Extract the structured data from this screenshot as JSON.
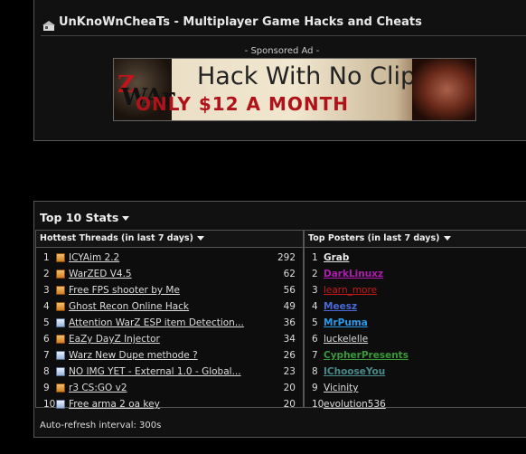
{
  "header": {
    "site_title": "UnKnoWnCheaTs - Multiplayer Game Hacks and Cheats",
    "sponsored_label": "- Sponsored Ad -"
  },
  "banner": {
    "logo_text_a": "WAr",
    "logo_text_b": "Z",
    "line1": "Hack With No Clip",
    "line2": "ONLY $12 A MONTH"
  },
  "stats": {
    "title": "Top 10 Stats",
    "threads_header": "Hottest Threads (in last 7 days)",
    "posters_header": "Top Posters (in last 7 days)",
    "threads": [
      {
        "n": "1",
        "title": "ICYAim 2.2",
        "count": "292",
        "icon": "hot"
      },
      {
        "n": "2",
        "title": "WarZED V4.5",
        "count": "62",
        "icon": "hot"
      },
      {
        "n": "3",
        "title": "Free FPS shooter by Me",
        "count": "56",
        "icon": "hot"
      },
      {
        "n": "4",
        "title": "Ghost Recon Online Hack",
        "count": "49",
        "icon": "hot"
      },
      {
        "n": "5",
        "title": "Attention WarZ ESP item Detection...",
        "count": "36",
        "icon": "cold"
      },
      {
        "n": "6",
        "title": "EaZy DayZ Injector",
        "count": "34",
        "icon": "hot"
      },
      {
        "n": "7",
        "title": "Warz New Dupe methode ?",
        "count": "26",
        "icon": "cold"
      },
      {
        "n": "8",
        "title": "NO IMG YET - External 1.0 - Global...",
        "count": "23",
        "icon": "cold"
      },
      {
        "n": "9",
        "title": "r3 CS:GO v2",
        "count": "20",
        "icon": "hot"
      },
      {
        "n": "10",
        "title": "Free arma 2 oa key",
        "count": "20",
        "icon": "cold"
      }
    ],
    "posters": [
      {
        "n": "1",
        "name": "Grab",
        "color": "#e8e8e8",
        "bold": true
      },
      {
        "n": "2",
        "name": "DarkLinuxz",
        "color": "#b01ab0",
        "bold": true
      },
      {
        "n": "3",
        "name": "learn_more",
        "color": "#c81818",
        "bold": false
      },
      {
        "n": "4",
        "name": "Meesz",
        "color": "#4a6ad8",
        "bold": true
      },
      {
        "n": "5",
        "name": "MrPuma",
        "color": "#2a9ae8",
        "bold": true
      },
      {
        "n": "6",
        "name": "luckelelle",
        "color": "#dddddd",
        "bold": false
      },
      {
        "n": "7",
        "name": "CypherPresents",
        "color": "#3a9a3a",
        "bold": true
      },
      {
        "n": "8",
        "name": "IChooseYou",
        "color": "#4a8a8a",
        "bold": true
      },
      {
        "n": "9",
        "name": "Vicinity",
        "color": "#dddddd",
        "bold": false
      },
      {
        "n": "10",
        "name": "evolution536",
        "color": "#dddddd",
        "bold": false
      }
    ],
    "autorefresh": "Auto-refresh interval: 300s"
  }
}
